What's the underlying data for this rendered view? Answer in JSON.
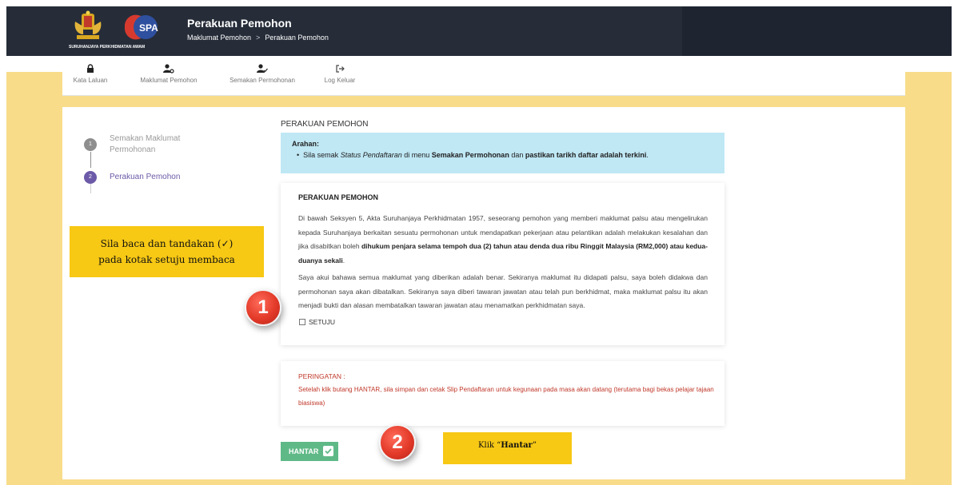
{
  "header": {
    "logo_caption": "SURUHANJAYA PERKHIDMATAN AWAM",
    "title": "Perakuan Pemohon",
    "breadcrumb": [
      "Maklumat Pemohon",
      "Perakuan Pemohon"
    ],
    "breadcrumb_sep": ">"
  },
  "nav": {
    "items": [
      {
        "label": "Kata Laluan",
        "icon": "lock-icon"
      },
      {
        "label": "Maklumat Pemohon",
        "icon": "user-settings-icon"
      },
      {
        "label": "Semakan Permohonan",
        "icon": "user-check-icon"
      },
      {
        "label": "Log Keluar",
        "icon": "logout-icon"
      }
    ]
  },
  "steps": [
    {
      "number": "1",
      "label_line1": "Semakan Maklumat",
      "label_line2": "Permohonan"
    },
    {
      "number": "2",
      "label_line1": "Perakuan Pemohon"
    }
  ],
  "section_title": "PERAKUAN PEMOHON",
  "info": {
    "title": "Arahan:",
    "text_1": "Sila semak ",
    "text_italic": "Status Pendaftaran",
    "text_2": " di menu ",
    "text_bold_1": "Semakan Permohonan",
    "text_3": " dan ",
    "text_bold_2": "pastikan tarikh daftar adalah terkini",
    "text_4": "."
  },
  "declaration": {
    "title": "PERAKUAN PEMOHON",
    "para1_normal": "Di bawah Seksyen 5, Akta Suruhanjaya Perkhidmatan 1957, seseorang pemohon yang memberi maklumat palsu atau mengelirukan kepada Suruhanjaya berkaitan sesuatu permohonan untuk mendapatkan pekerjaan atau pelantikan adalah melakukan kesalahan dan jika disabitkan boleh ",
    "para1_bold": "dihukum penjara selama tempoh dua (2) tahun atau denda dua ribu Ringgit Malaysia (RM2,000) atau kedua-duanya sekali",
    "para1_end": ".",
    "para2": "Saya akui bahawa semua maklumat yang diberikan adalah benar. Sekiranya maklumat itu didapati palsu, saya boleh didakwa dan permohonan saya akan dibatalkan. Sekiranya saya diberi tawaran jawatan atau telah pun berkhidmat, maka maklumat palsu itu akan menjadi bukti dan alasan membatalkan tawaran jawatan atau menamatkan perkhidmatan saya.",
    "checkbox_label": "SETUJU",
    "checkbox_checked": false
  },
  "warning": {
    "title": "PERINGATAN :",
    "text": "Setelah klik butang HANTAR, sila simpan dan cetak Slip Pendaftaran untuk kegunaan pada masa akan datang (terutama bagi bekas pelajar tajaan biasiswa)"
  },
  "submit_label": "HANTAR",
  "annotations": {
    "callout1_line1": "Sila baca dan tandakan (✓)",
    "callout1_line2": "pada kotak setuju membaca",
    "badge1": "1",
    "badge2": "2",
    "callout2_prefix": "Klik “",
    "callout2_bold": "Hantar",
    "callout2_suffix": "”"
  },
  "colors": {
    "header_bg": "#262d39",
    "page_bg": "#f8dc8a",
    "info_bg": "#bfe7f4",
    "step_active": "#6c5aa8",
    "step_done": "#8e8e8e",
    "warning_text": "#c0392b",
    "submit_bg": "#5fb987",
    "callout_bg": "#f7c814",
    "badge_red": "#e33a29"
  }
}
